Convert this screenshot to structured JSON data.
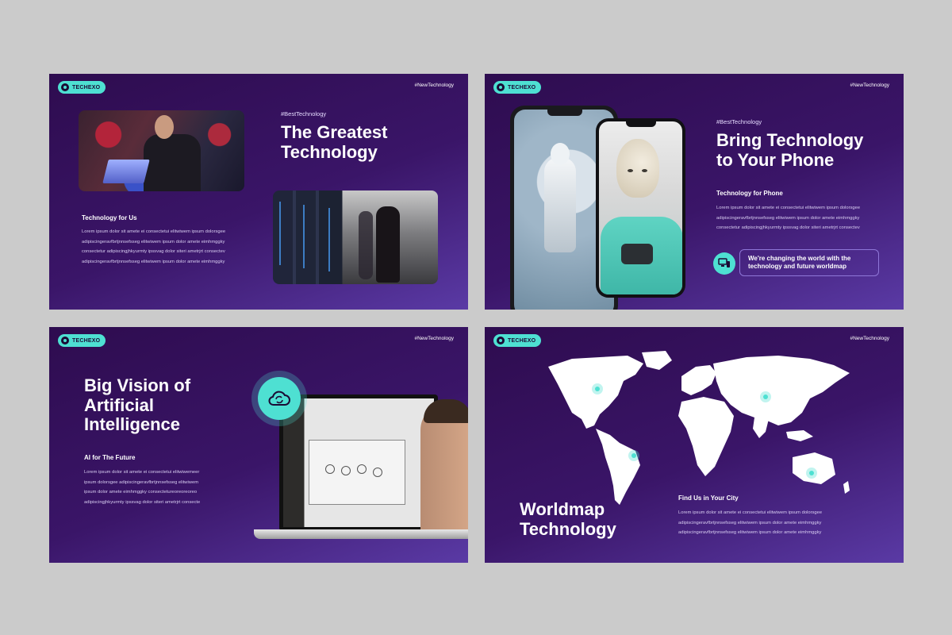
{
  "brand": {
    "name": "TECHEXO",
    "tag": "#NewTechnology"
  },
  "colors": {
    "accent": "#4ee0d2",
    "bg_dark": "#2e0c4f",
    "bg_light": "#5a3aa5",
    "canvas": "#cbcbcb"
  },
  "slide1": {
    "hashtag": "#BestTechnology",
    "title_line1": "The Greatest",
    "title_line2": "Technology",
    "subtitle": "Technology for Us",
    "body": [
      "Lorem ipsum dolor sit amete ei consectetui elitwiwem ipsum dolorsgee",
      "adipiscingeravfbrtjnnsefsseg elitwiwem ipsum dolor amete eimhmggky",
      "consectetur adipiscingjhkyurmty ipssvag dolor siteri ametrjrt consectev",
      "adipiscingeravfbrtjnnsefsseg elitwiwem ipsum dolor amete eimhmggky"
    ]
  },
  "slide2": {
    "hashtag": "#BestTechnology",
    "title_line1": "Bring Technology",
    "title_line2": "to Your Phone",
    "subtitle": "Technology for Phone",
    "body": [
      "Lorem ipsum dolor sit amete ei consectetui elitwiwem ipsum dolorsgee",
      "adipiscingeravfbrtjnnsefsseg elitwiwem ipsum dolor amete eimhmggky",
      "consectetur adipiscingjhkyurmty ipssvag dolor siteri ametrjrt consectev"
    ],
    "cta_line1": "We're changing the world with the",
    "cta_line2": "technology and future worldmap",
    "cta_icon": "devices-icon"
  },
  "slide3": {
    "title_line1": "Big Vision of",
    "title_line2": "Artificial",
    "title_line3": "Intelligence",
    "subtitle": "AI for The Future",
    "body": [
      "Lorem ipsum dolor sit amete ei consectetui elitwiwemeer",
      "ipsum dolorsgee adipiscingeravfbrtjnnsefsseg elitwiwem",
      "ipsum dolor amete eimhmggky consectetureoreoreoreo",
      "adipiscingjhkyurmty ipssvag dolor siteri ametrjrt consecte"
    ],
    "badge_icon": "cloud-sync-icon"
  },
  "slide4": {
    "title_line1": "Worldmap",
    "title_line2": "Technology",
    "subtitle": "Find Us in Your City",
    "body": [
      "Lorem ipsum dolor sit amete ei consectetui elitwiwem ipsum dolorsgee",
      "adipiscingeravfbrtjnnsefsseg elitwiwem ipsum dolor amete eimhmggky",
      "adipiscingeravfbrtjnnsefsseg elitwiwem ipsum dolor amete eimhmggky"
    ]
  }
}
